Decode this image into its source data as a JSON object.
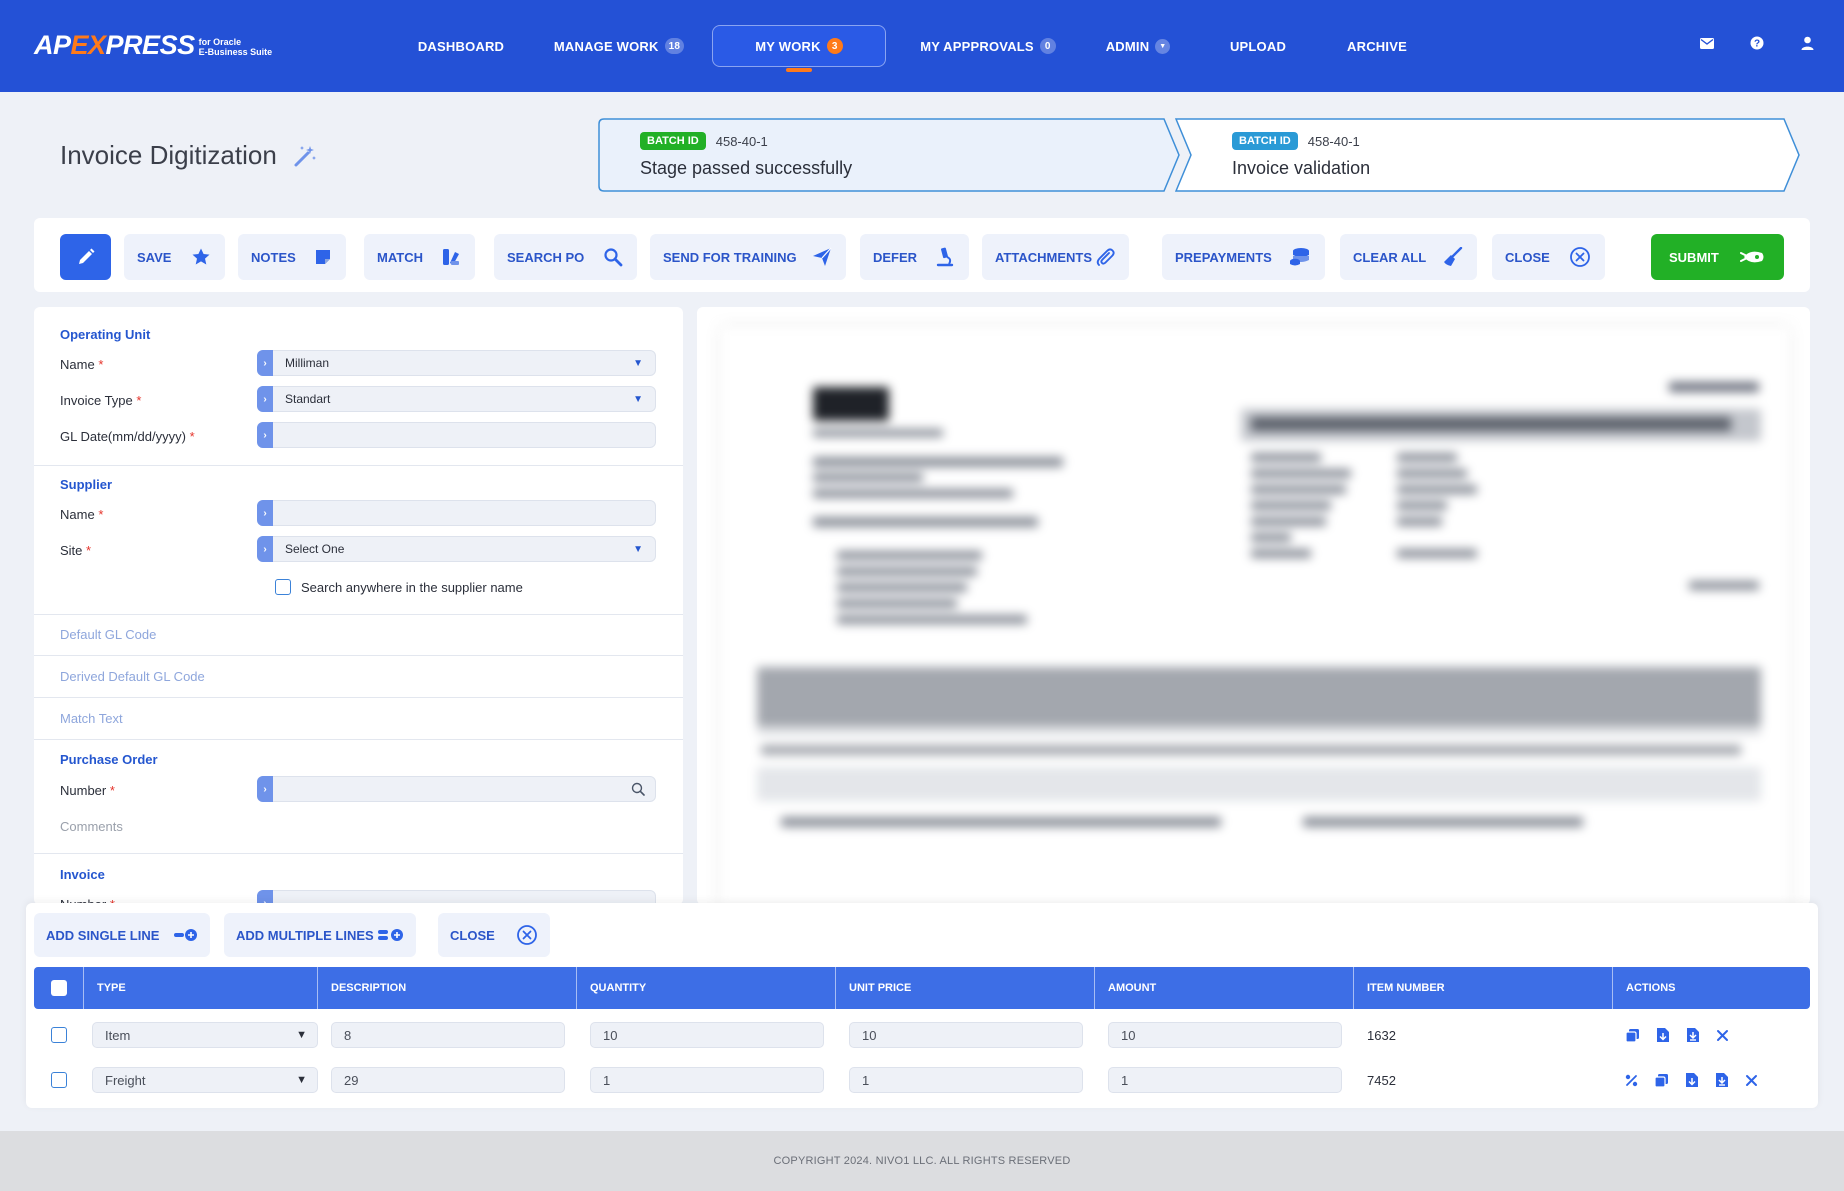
{
  "app": {
    "logo_main_a": "AP",
    "logo_main_x": "EX",
    "logo_main_b": "PRESS",
    "logo_sub_1": "for Oracle",
    "logo_sub_2": "E-Business Suite"
  },
  "nav": {
    "dashboard": "DASHBOARD",
    "manage_work": "MANAGE WORK",
    "manage_work_count": "18",
    "my_work": "MY WORK",
    "my_work_count": "3",
    "my_approvals": "MY APPPROVALS",
    "my_approvals_count": "0",
    "admin": "ADMIN",
    "upload": "UPLOAD",
    "archive": "ARCHIVE"
  },
  "page": {
    "title": "Invoice Digitization"
  },
  "stages": [
    {
      "tag": "BATCH ID",
      "id": "458-40-1",
      "text": "Stage passed successfully",
      "tag_color": "#22b026"
    },
    {
      "tag": "BATCH ID",
      "id": "458-40-1",
      "text": "Invoice validation",
      "tag_color": "#2a9ad6"
    }
  ],
  "toolbar": {
    "save": "SAVE",
    "notes": "NOTES",
    "match": "MATCH",
    "search_po": "SEARCH PO",
    "send_for_training": "SEND FOR TRAINING",
    "defer": "DEFER",
    "attachments": "ATTACHMENTS",
    "prepayments": "PREPAYMENTS",
    "clear_all": "CLEAR ALL",
    "close": "CLOSE",
    "submit": "SUBMIT"
  },
  "form": {
    "operating_unit": {
      "title": "Operating Unit",
      "name_label": "Name",
      "name_value": "Milliman",
      "invoice_type_label": "Invoice Type",
      "invoice_type_value": "Standart",
      "gl_date_label": "GL Date(mm/dd/yyyy)",
      "gl_date_value": ""
    },
    "supplier": {
      "title": "Supplier",
      "name_label": "Name",
      "name_value": "",
      "site_label": "Site",
      "site_value": "Select One",
      "search_anywhere": "Search anywhere in the supplier name"
    },
    "default_gl_code": "Default GL Code",
    "derived_default_gl_code": "Derived Default GL Code",
    "match_text": "Match Text",
    "purchase_order": {
      "title": "Purchase Order",
      "number_label": "Number",
      "number_value": "",
      "comments_label": "Comments"
    },
    "invoice": {
      "title": "Invoice",
      "number_label": "Number"
    },
    "required_mark": "*"
  },
  "lines": {
    "add_single": "ADD SINGLE LINE",
    "add_multiple": "ADD MULTIPLE LINES",
    "close": "CLOSE",
    "columns": [
      "TYPE",
      "DESCRIPTION",
      "QUANTITY",
      "UNIT PRICE",
      "AMOUNT",
      "ITEM NUMBER",
      "ACTIONS"
    ],
    "rows": [
      {
        "type": "Item",
        "description": "8",
        "quantity": "10",
        "unit_price": "10",
        "amount": "10",
        "item_number": "1632"
      },
      {
        "type": "Freight",
        "description": "29",
        "quantity": "1",
        "unit_price": "1",
        "amount": "1",
        "item_number": "7452"
      }
    ]
  },
  "footer": {
    "text": "COPYRIGHT 2024. NIVO1 LLC. ALL RIGHTS RESERVED"
  },
  "colors": {
    "header": "#2451d6",
    "accent": "#ff7a1a",
    "primary": "#2e64e8",
    "success": "#22b026"
  }
}
